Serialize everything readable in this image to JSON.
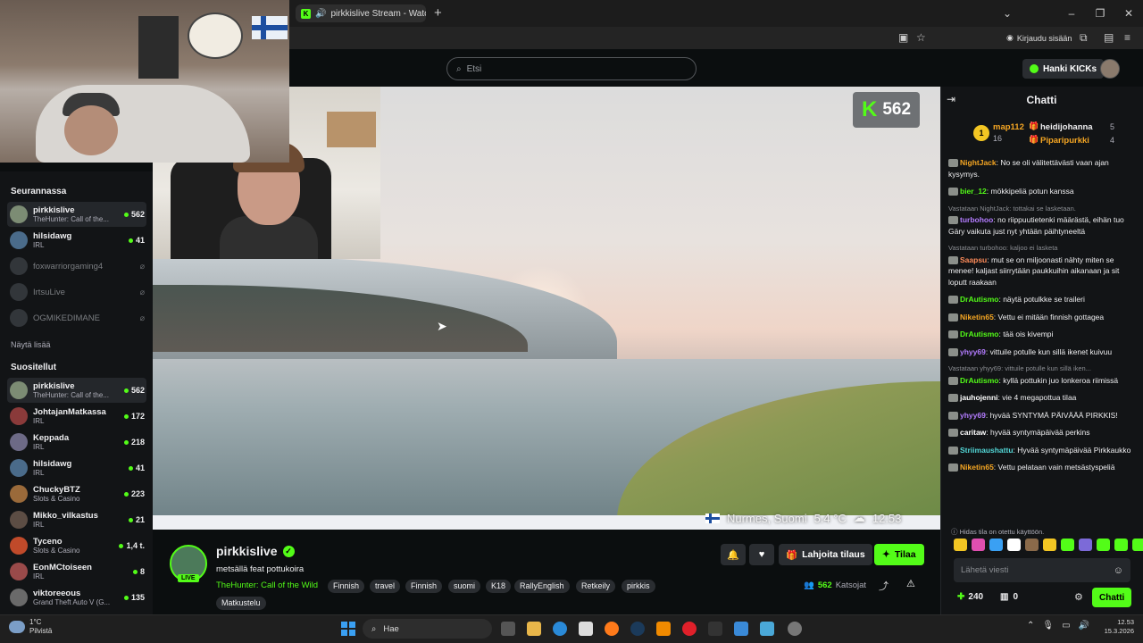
{
  "browser": {
    "tab_title": "pirkkislive Stream - Watch l",
    "sign_in": "Kirjaudu sisään"
  },
  "header": {
    "search_placeholder": "Etsi",
    "get_kicks": "Hanki KICKs"
  },
  "sidebar": {
    "following_title": "Seurannassa",
    "following": [
      {
        "name": "pirkkislive",
        "category": "TheHunter: Call of the...",
        "viewers": "562",
        "live": true
      },
      {
        "name": "hilsidawg",
        "category": "IRL",
        "viewers": "41",
        "live": true
      },
      {
        "name": "foxwarriorgaming4",
        "category": "",
        "viewers": "",
        "live": false
      },
      {
        "name": "IrtsuLive",
        "category": "",
        "viewers": "",
        "live": false
      },
      {
        "name": "OGMIKEDIMANE",
        "category": "",
        "viewers": "",
        "live": false
      }
    ],
    "show_more": "Näytä lisää",
    "recommended_title": "Suositellut",
    "recommended": [
      {
        "name": "pirkkislive",
        "category": "TheHunter: Call of the...",
        "viewers": "562"
      },
      {
        "name": "JohtajanMatkassa",
        "category": "IRL",
        "viewers": "172"
      },
      {
        "name": "Keppada",
        "category": "IRL",
        "viewers": "218"
      },
      {
        "name": "hilsidawg",
        "category": "IRL",
        "viewers": "41"
      },
      {
        "name": "ChuckyBTZ",
        "category": "Slots & Casino",
        "viewers": "223"
      },
      {
        "name": "Mikko_vilkastus",
        "category": "IRL",
        "viewers": "21"
      },
      {
        "name": "Tyceno",
        "category": "Slots & Casino",
        "viewers": "1,4 t."
      },
      {
        "name": "EonMCtoiseen",
        "category": "IRL",
        "viewers": "8"
      },
      {
        "name": "viktoreeous",
        "category": "Grand Theft Auto V (G...",
        "viewers": "135"
      }
    ]
  },
  "video": {
    "viewer_count": "562",
    "overlay_location": "Nurmes, Suomi",
    "overlay_temp": "5.4 °C",
    "overlay_time": "12.53"
  },
  "stream": {
    "streamer": "pirkkislive",
    "live_label": "LIVE",
    "title": "metsällä feat pottukoira",
    "category": "TheHunter: Call of the Wild",
    "tags": [
      "Finnish",
      "travel",
      "Finnish",
      "suomi",
      "K18",
      "RallyEnglish",
      "Retkeily",
      "pirkkis",
      "Matkustelu"
    ],
    "gift_label": "Lahjoita tilaus",
    "subscribe_label": "Tilaa",
    "viewers": "562",
    "viewers_label": "Katsojat"
  },
  "chat": {
    "title": "Chatti",
    "leaderboard": [
      {
        "rank": "1",
        "name": "map112",
        "count": "16"
      },
      {
        "name": "heidijohanna",
        "count": "5"
      },
      {
        "name": "Piparipurkki",
        "count": "4"
      }
    ],
    "messages": [
      {
        "reply": "",
        "user": "NightJack",
        "color": "#f5a623",
        "text": "No se oli välitettävästi vaan ajan kysymys."
      },
      {
        "reply": "",
        "user": "bier_12",
        "color": "#53fc18",
        "text": "mökkipeliä potun kanssa"
      },
      {
        "reply": "Vastataan NightJack: tottakai se lasketaan.",
        "user": "turbohoo",
        "color": "#b37cff",
        "text": "no riippuutietenki määrästä, eihän tuo Gäry vaikuta just nyt yhtään päihtyneeltä"
      },
      {
        "reply": "Vastataan turbohoo: kaljoo ei lasketa",
        "user": "Saapsu",
        "color": "#ff8c5a",
        "text": "mut se on miljoonasti nähty miten se menee! kaljast siirrytään paukkuihin aikanaan ja sit loputt raakaan"
      },
      {
        "reply": "",
        "user": "DrAutismo",
        "color": "#53fc18",
        "text": "näytä potulkke se traileri"
      },
      {
        "reply": "",
        "user": "Niketin65",
        "color": "#f5a623",
        "text": "Vettu ei mitään finnish gottagea"
      },
      {
        "reply": "",
        "user": "DrAutismo",
        "color": "#53fc18",
        "text": "tää ois kivempi"
      },
      {
        "reply": "",
        "user": "yhyy69",
        "color": "#b37cff",
        "text": "vittuile potulle kun sillä ikenet kuivuu"
      },
      {
        "reply": "Vastataan yhyy69: vittuile potulle kun sillä iken...",
        "user": "DrAutismo",
        "color": "#53fc18",
        "text": "kyllä pottukin juo lonkeroa riimissä"
      },
      {
        "reply": "",
        "user": "jauhojenni",
        "color": "#ffffff",
        "text": "vie 4 megapottua tilaa"
      },
      {
        "reply": "",
        "user": "yhyy69",
        "color": "#b37cff",
        "text": "hyvää SYNTYMÄ PÄIVÄÄÄ PIRKKIS!"
      },
      {
        "reply": "",
        "user": "caritaw",
        "color": "#ffffff",
        "text": "hyvää syntymäpäivää perkins"
      },
      {
        "reply": "",
        "user": "Striimaushattu",
        "color": "#53d8d8",
        "text": "Hyvää syntymäpäivää Pirkkaukko"
      },
      {
        "reply": "",
        "user": "Niketin65",
        "color": "#f5a623",
        "text": "Vettu pelataan vain metsästyspeliä"
      }
    ],
    "pinned": "Hidas tila on otettu käyttöön.",
    "input_placeholder": "Lähetä viesti",
    "kicks": "240",
    "store": "0",
    "send_label": "Chatti"
  },
  "taskbar": {
    "weather_temp": "1°C",
    "weather_desc": "Pilvistä",
    "search_label": "Hae",
    "time": "12.53",
    "date": "15.3.2026"
  },
  "colors": {
    "accent": "#53fc18",
    "background": "#0b0e0f",
    "panel": "#121416"
  }
}
